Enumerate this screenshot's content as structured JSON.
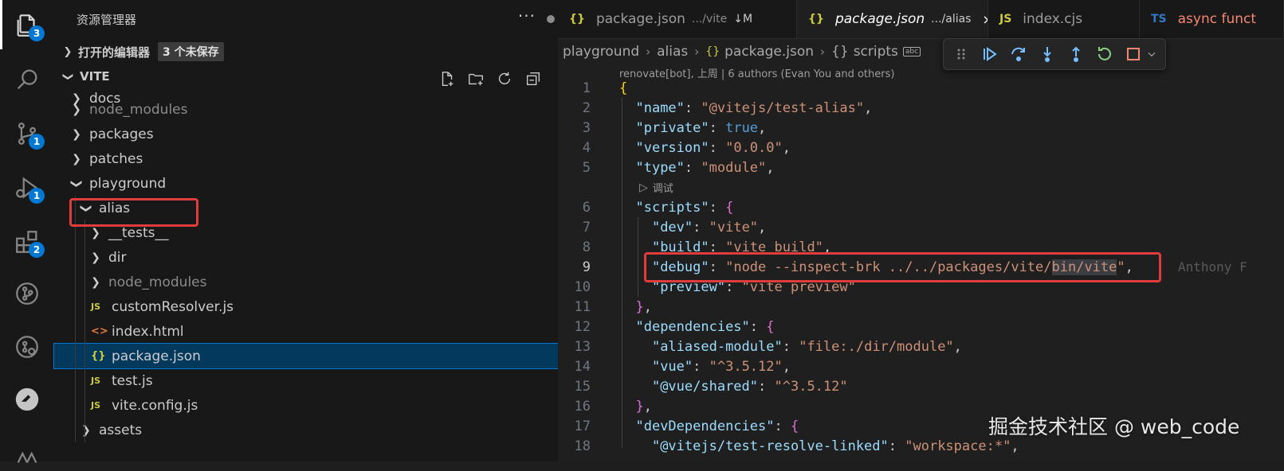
{
  "activity_bar": {
    "items": [
      {
        "icon": "explorer-icon",
        "badge": "3"
      },
      {
        "icon": "search-icon",
        "badge": ""
      },
      {
        "icon": "source-control-icon",
        "badge": "1"
      },
      {
        "icon": "run-debug-icon",
        "badge": "1"
      },
      {
        "icon": "extensions-icon",
        "badge": "2"
      },
      {
        "icon": "git-graph-icon",
        "badge": ""
      },
      {
        "icon": "remote-explorer-icon",
        "badge": ""
      },
      {
        "icon": "gitlens-icon",
        "badge": ""
      }
    ]
  },
  "sidebar": {
    "title": "资源管理器",
    "more": "···",
    "open_editors": {
      "label": "打开的编辑器",
      "badge": "3 个未保存"
    },
    "project": {
      "label": "VITE"
    },
    "tree": [
      {
        "label": "docs",
        "type": "folder",
        "expanded": false,
        "dim": false
      },
      {
        "label": "node_modules",
        "type": "folder",
        "expanded": false,
        "dim": true
      },
      {
        "label": "packages",
        "type": "folder",
        "expanded": false,
        "dim": false
      },
      {
        "label": "patches",
        "type": "folder",
        "expanded": false,
        "dim": false
      },
      {
        "label": "playground",
        "type": "folder",
        "expanded": true,
        "dim": false
      },
      {
        "label": "alias",
        "type": "folder",
        "expanded": true,
        "dim": false
      },
      {
        "label": "__tests__",
        "type": "folder",
        "expanded": false,
        "dim": false
      },
      {
        "label": "dir",
        "type": "folder",
        "expanded": false,
        "dim": false
      },
      {
        "label": "node_modules",
        "type": "folder",
        "expanded": false,
        "dim": true
      },
      {
        "label": "customResolver.js",
        "type": "js",
        "icon_text": "JS"
      },
      {
        "label": "index.html",
        "type": "html",
        "icon_text": "<>"
      },
      {
        "label": "package.json",
        "type": "json",
        "icon_text": "{}",
        "selected": true
      },
      {
        "label": "test.js",
        "type": "js",
        "icon_text": "JS"
      },
      {
        "label": "vite.config.js",
        "type": "js",
        "icon_text": "JS"
      },
      {
        "label": "assets",
        "type": "folder",
        "expanded": false,
        "dim": false
      }
    ]
  },
  "tabs": [
    {
      "icon_text": "{}",
      "label": "package.json",
      "desc": ".../vite",
      "status": "↓M",
      "active": false
    },
    {
      "icon_text": "{}",
      "label": "package.json",
      "desc": ".../alias",
      "close": "×",
      "active": true
    },
    {
      "icon_text": "JS",
      "label": "index.cjs",
      "active": false
    },
    {
      "icon_text": "TS",
      "label": "async funct",
      "active": false
    }
  ],
  "breadcrumb": [
    "playground",
    "alias",
    "package.json",
    "scripts"
  ],
  "blame_top": "renovate[bot], 上周 | 6 authors (Evan You and others)",
  "codelens": "调试",
  "blame_inline": "Anthony F",
  "code_lines": [
    {
      "n": "1"
    },
    {
      "n": "2"
    },
    {
      "n": "3"
    },
    {
      "n": "4"
    },
    {
      "n": "5"
    },
    {
      "n": "6"
    },
    {
      "n": "7"
    },
    {
      "n": "8"
    },
    {
      "n": "9"
    },
    {
      "n": "10"
    },
    {
      "n": "11"
    },
    {
      "n": "12"
    },
    {
      "n": "13"
    },
    {
      "n": "14"
    },
    {
      "n": "15"
    },
    {
      "n": "16"
    },
    {
      "n": "17"
    },
    {
      "n": "18"
    }
  ],
  "code": {
    "name_k": "\"name\"",
    "name_v": "\"@vitejs/test-alias\"",
    "private_k": "\"private\"",
    "private_v": "true",
    "version_k": "\"version\"",
    "version_v": "\"0.0.0\"",
    "type_k": "\"type\"",
    "type_v": "\"module\"",
    "scripts_k": "\"scripts\"",
    "dev_k": "\"dev\"",
    "dev_v": "\"vite\"",
    "build_k": "\"build\"",
    "build_v": "\"vite build\"",
    "debug_k": "\"debug\"",
    "debug_v1": "\"node --inspect-brk ../../packages/vite/",
    "debug_v2": "bin/vite",
    "debug_v3": "\"",
    "preview_k": "\"preview\"",
    "preview_v": "\"vite preview\"",
    "deps_k": "\"dependencies\"",
    "aliased_k": "\"aliased-module\"",
    "aliased_v": "\"file:./dir/module\"",
    "vue_k": "\"vue\"",
    "vue_v": "\"^3.5.12\"",
    "shared_k": "\"@vue/shared\"",
    "shared_v": "\"^3.5.12\"",
    "devdeps_k": "\"devDependencies\"",
    "linked_k": "\"@vitejs/test-resolve-linked\"",
    "linked_v": "\"workspace:*\""
  },
  "watermark": "掘金技术社区 @ web_code",
  "colors": {
    "accent": "#0078d4",
    "highlight_box": "#e03c3c",
    "selected_row": "#04395e"
  }
}
